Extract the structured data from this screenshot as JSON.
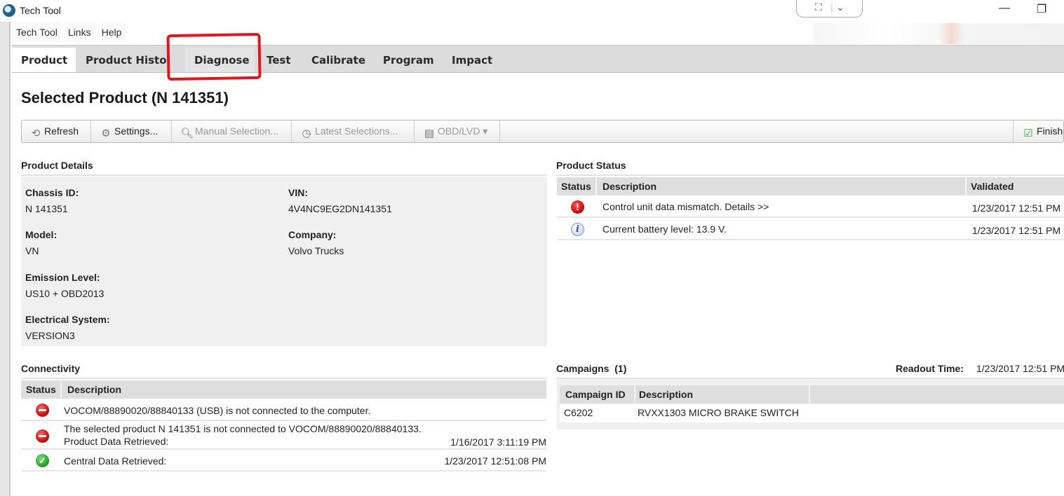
{
  "window": {
    "title": "Tech Tool",
    "snap_icons": [
      "expand-icon",
      "chevron-down-icon"
    ],
    "controls": {
      "minimize": "—",
      "restore": "❐"
    }
  },
  "menubar": [
    "Tech Tool",
    "Links",
    "Help"
  ],
  "tabs": [
    {
      "label": "Product",
      "active": true
    },
    {
      "label": "Product History",
      "active": false
    },
    {
      "label": "Diagnose",
      "active": false,
      "highlighted": true
    },
    {
      "label": "Test",
      "active": false
    },
    {
      "label": "Calibrate",
      "active": false
    },
    {
      "label": "Program",
      "active": false
    },
    {
      "label": "Impact",
      "active": false
    }
  ],
  "page_title": "Selected Product (N 141351)",
  "toolbar": {
    "refresh": "Refresh",
    "settings": "Settings...",
    "manual_selection": "Manual Selection...",
    "latest_selections": "Latest Selections...",
    "obd_lvd": "OBD/LVD ▾",
    "finish_work": "Finish Work"
  },
  "product_details": {
    "heading": "Product Details",
    "fields": [
      {
        "label": "Chassis ID:",
        "value": "N 141351"
      },
      {
        "label": "VIN:",
        "value": "4V4NC9EG2DN141351"
      },
      {
        "label": "Model:",
        "value": "VN"
      },
      {
        "label": "Company:",
        "value": "Volvo Trucks"
      },
      {
        "label": "Emission Level:",
        "value": "US10 + OBD2013"
      },
      {
        "label": "Electrical System:",
        "value": "VERSION3"
      }
    ]
  },
  "product_status": {
    "heading": "Product Status",
    "columns": [
      "Status",
      "Description",
      "Validated"
    ],
    "rows": [
      {
        "status": "error",
        "icon": "!",
        "description": "Control unit data mismatch. Details >>",
        "validated": "1/23/2017 12:51 PM"
      },
      {
        "status": "info",
        "icon": "i",
        "description": "Current battery level: 13.9 V.",
        "validated": "1/23/2017 12:51 PM"
      }
    ]
  },
  "connectivity": {
    "heading": "Connectivity",
    "columns": [
      "Status",
      "Description"
    ],
    "rows": [
      {
        "status": "error",
        "description": "VOCOM/88890020/88840133 (USB) is not connected to the computer.",
        "sub": "",
        "time": ""
      },
      {
        "status": "error",
        "description": "The selected product N 141351 is not connected to VOCOM/88890020/88840133.",
        "sub": "Product Data Retrieved:",
        "time": "1/16/2017 3:11:19 PM"
      },
      {
        "status": "ok",
        "description": "Central Data Retrieved:",
        "sub": "",
        "time": "1/23/2017 12:51:08 PM"
      }
    ]
  },
  "campaigns": {
    "heading": "Campaigns",
    "count": "(1)",
    "readout_label": "Readout Time:",
    "readout_time": "1/23/2017 12:51 PM",
    "columns": [
      "Campaign ID",
      "Description"
    ],
    "rows": [
      {
        "id": "C6202",
        "description": "RVXX1303 MICRO BRAKE SWITCH"
      }
    ]
  },
  "icons": {
    "ok_glyph": "✓"
  }
}
